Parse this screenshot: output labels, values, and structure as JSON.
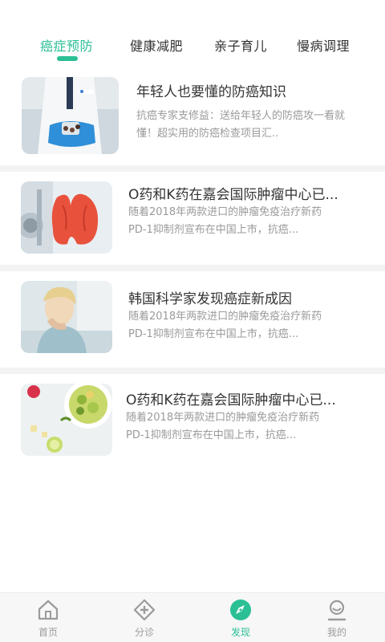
{
  "tabs": [
    {
      "label": "癌症预防",
      "active": true
    },
    {
      "label": "健康减肥",
      "active": false
    },
    {
      "label": "亲子育儿",
      "active": false
    },
    {
      "label": "慢病调理",
      "active": false
    }
  ],
  "articles": [
    {
      "title": "年轻人也要懂的防癌知识",
      "desc_line1": "抗癌专家支修益：送给年轻人的防癌攻一看就",
      "desc_line2": "懂！超实用的防癌检查项目汇..",
      "image": "doctor-holding-pills-image"
    },
    {
      "title": "O药和K药在嘉会国际肿瘤中心已...",
      "desc_line1": "随着2018年两款进口的肿瘤免疫治疗新药",
      "desc_line2": "PD-1抑制剂宣布在中国上市，抗癌...",
      "image": "thyroid-model-image"
    },
    {
      "title": "韩国科学家发现癌症新成因",
      "desc_line1": "随着2018年两款进口的肿瘤免疫治疗新药",
      "desc_line2": "PD-1抑制剂宣布在中国上市，抗癌...",
      "image": "woman-coughing-image"
    },
    {
      "title": "O药和K药在嘉会国际肿瘤中心已...",
      "desc_line1": "随着2018年两款进口的肿瘤免疫治疗新药",
      "desc_line2": "PD-1抑制剂宣布在中国上市，抗癌...",
      "image": "healthy-salad-image"
    }
  ],
  "bottom_nav": [
    {
      "label": "首页",
      "icon": "home-icon",
      "active": false
    },
    {
      "label": "分诊",
      "icon": "triage-icon",
      "active": false
    },
    {
      "label": "发现",
      "icon": "compass-icon",
      "active": true
    },
    {
      "label": "我的",
      "icon": "profile-icon",
      "active": false
    }
  ],
  "colors": {
    "accent": "#2bbf95",
    "text_primary": "#333333",
    "text_secondary": "#9a9a9a",
    "separator": "#f3f3f3"
  }
}
